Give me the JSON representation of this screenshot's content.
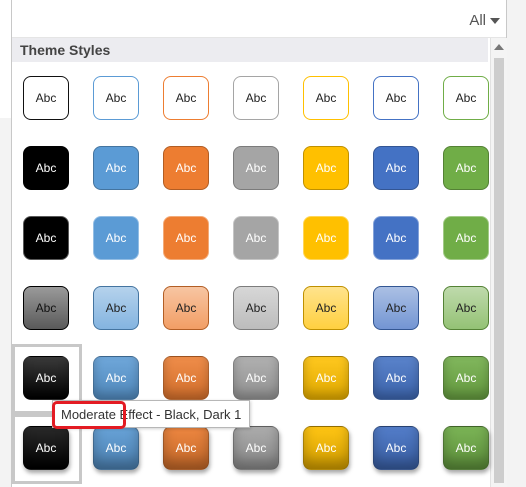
{
  "filter": {
    "label": "All"
  },
  "section": {
    "title": "Theme Styles"
  },
  "tooltip": {
    "text": "Moderate Effect - Black, Dark 1",
    "highlight_word": "Moderate"
  },
  "tile_label": "Abc",
  "colors": {
    "black": "#000000",
    "blue": "#5b9bd5",
    "orange": "#ed7d31",
    "gray": "#a5a5a5",
    "gold": "#ffc000",
    "darkblue": "#4472c4",
    "green": "#70ad47"
  },
  "color_order": [
    "black",
    "blue",
    "orange",
    "gray",
    "gold",
    "darkblue",
    "green"
  ],
  "rows": [
    {
      "style": "colored-outline"
    },
    {
      "style": "colored-fill"
    },
    {
      "style": "light-fill"
    },
    {
      "style": "subtle-effect"
    },
    {
      "style": "moderate-effect"
    },
    {
      "style": "intense-effect"
    }
  ],
  "selected": {
    "row": 4,
    "col": 0
  }
}
